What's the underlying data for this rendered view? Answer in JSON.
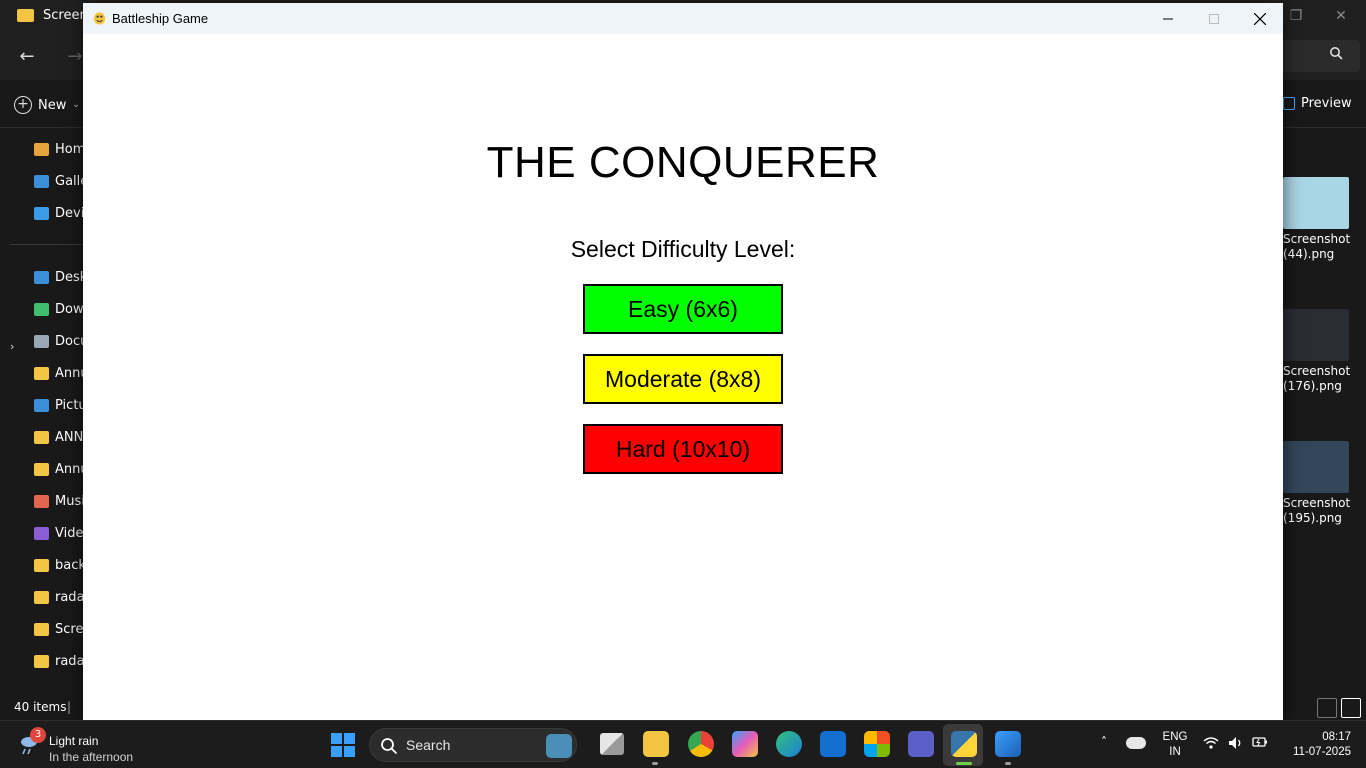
{
  "explorer": {
    "tab_title": "Screens",
    "new_label": "New",
    "preview_label": "Preview",
    "sidebar_items": [
      {
        "label": "Home",
        "icon": "home-icon",
        "color": "#e8a33c"
      },
      {
        "label": "Gallery",
        "icon": "gallery-icon",
        "color": "#3a8fd8"
      },
      {
        "label": "Devip",
        "icon": "onedrive-icon",
        "color": "#3a9be6"
      },
      {
        "label": "Desktop",
        "icon": "desktop-icon",
        "color": "#3a8fd8"
      },
      {
        "label": "Downloads",
        "icon": "download-icon",
        "color": "#3fbf6e"
      },
      {
        "label": "Documents",
        "icon": "document-icon",
        "color": "#9aa7b4"
      },
      {
        "label": "Annu",
        "icon": "folder-icon",
        "color": "#f4c542"
      },
      {
        "label": "Pictures",
        "icon": "pictures-icon",
        "color": "#3a8fd8"
      },
      {
        "label": "ANNU",
        "icon": "folder-icon",
        "color": "#f4c542"
      },
      {
        "label": "Annu",
        "icon": "folder-icon",
        "color": "#f4c542"
      },
      {
        "label": "Music",
        "icon": "music-icon",
        "color": "#e2664e"
      },
      {
        "label": "Videos",
        "icon": "video-icon",
        "color": "#8a5cd6"
      },
      {
        "label": "backg",
        "icon": "folder-icon",
        "color": "#f4c542"
      },
      {
        "label": "radar",
        "icon": "folder-icon",
        "color": "#f4c542"
      },
      {
        "label": "Scree",
        "icon": "folder-icon",
        "color": "#f4c542"
      },
      {
        "label": "radar",
        "icon": "folder-icon",
        "color": "#f4c542"
      }
    ],
    "status_items": "40 items",
    "status_sep": "|",
    "files": [
      {
        "label": "Screenshot (44).png",
        "thumb_color": "#a9d6e5"
      },
      {
        "label": "Screenshot (176).png",
        "thumb_color": "#2a2d33"
      },
      {
        "label": "Screenshot (195).png",
        "thumb_color": "#33465a"
      }
    ]
  },
  "game_window": {
    "title": "Battleship Game",
    "heading": "THE CONQUERER",
    "select_label": "Select Difficulty Level:",
    "buttons": [
      {
        "label": "Easy (6x6)",
        "color": "#00ff00"
      },
      {
        "label": "Moderate (8x8)",
        "color": "#ffff00"
      },
      {
        "label": "Hard (10x10)",
        "color": "#ff0000"
      }
    ]
  },
  "taskbar": {
    "weather_title": "Light rain",
    "weather_sub": "In the afternoon",
    "weather_badge": "3",
    "search_text": "Search",
    "lang_line1": "ENG",
    "lang_line2": "IN",
    "time": "08:17",
    "date": "11-07-2025",
    "apps": [
      "task-view-icon",
      "file-explorer-icon",
      "chrome-icon",
      "copilot-icon",
      "edge-icon",
      "outlook-icon",
      "store-icon",
      "teams-icon",
      "python-icon",
      "photos-icon"
    ]
  }
}
